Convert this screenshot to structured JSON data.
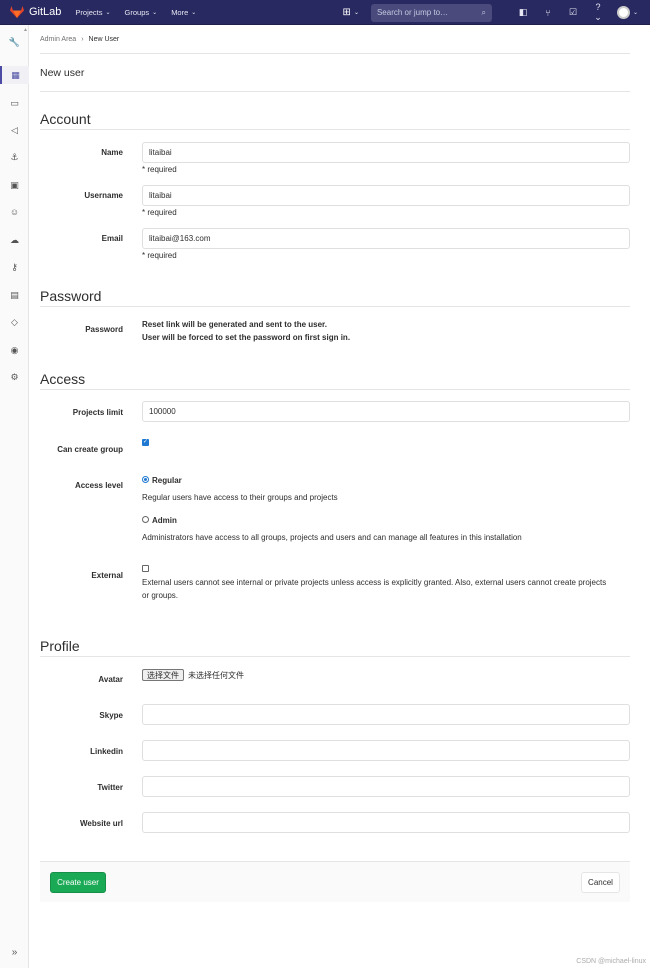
{
  "nav": {
    "brand": "GitLab",
    "links": [
      "Projects",
      "Groups",
      "More"
    ],
    "search_placeholder": "Search or jump to…"
  },
  "breadcrumb": {
    "parent": "Admin Area",
    "current": "New User"
  },
  "page_title": "New user",
  "account": {
    "title": "Account",
    "name_label": "Name",
    "name_value": "litaibai",
    "username_label": "Username",
    "username_value": "litaibai",
    "email_label": "Email",
    "email_value": "litaibai@163.com",
    "required": "* required"
  },
  "password": {
    "title": "Password",
    "label": "Password",
    "line1": "Reset link will be generated and sent to the user.",
    "line2": "User will be forced to set the password on first sign in."
  },
  "access": {
    "title": "Access",
    "projects_limit_label": "Projects limit",
    "projects_limit_value": "100000",
    "can_create_group_label": "Can create group",
    "can_create_group_checked": true,
    "access_level_label": "Access level",
    "regular_label": "Regular",
    "regular_help": "Regular users have access to their groups and projects",
    "admin_label": "Admin",
    "admin_help": "Administrators have access to all groups, projects and users and can manage all features in this installation",
    "external_label": "External",
    "external_help_1": "External users cannot see internal or private projects unless access is explicitly granted. Also, external users cannot create projects",
    "external_help_2": "or groups."
  },
  "profile": {
    "title": "Profile",
    "avatar_label": "Avatar",
    "file_button": "选择文件",
    "file_status": "未选择任何文件",
    "skype_label": "Skype",
    "skype_value": "",
    "linkedin_label": "Linkedin",
    "linkedin_value": "",
    "twitter_label": "Twitter",
    "twitter_value": "",
    "website_label": "Website url",
    "website_value": ""
  },
  "actions": {
    "create": "Create user",
    "cancel": "Cancel"
  },
  "watermark": "CSDN @michael-linux",
  "colors": {
    "nav": "#292961",
    "create_button": "#1aaa55",
    "checkbox": "#1f78d1",
    "logo": "#e24329"
  }
}
